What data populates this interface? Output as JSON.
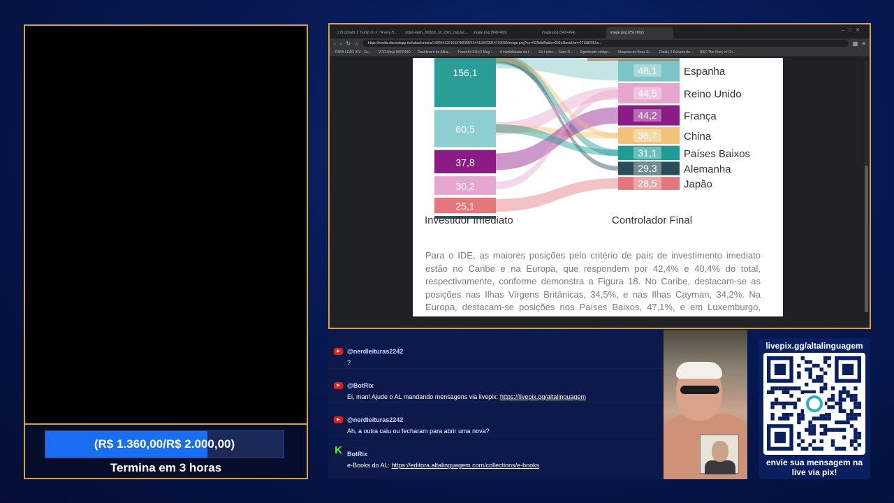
{
  "goal": {
    "progress_text": "(R$ 1.360,00/R$ 2.000,00)",
    "current": 1360,
    "target": 2000,
    "progress_fraction": 0.68,
    "ends_text": "Termina em 3 horas",
    "fill_color": "#1a6ff0"
  },
  "browser": {
    "tabs": [
      {
        "label": "(12) Donald J. Trump no X: \"A very H..."
      },
      {
        "label": "onpel-egim_200910_sri_2001_regulac..."
      },
      {
        "label": "image.png (848×493)"
      },
      {
        "label": "image.png (542×494)"
      },
      {
        "label": "image.png (751×902)"
      }
    ],
    "url": "https://media.discordapp.net/attachments/1435441291633758389/1444115623314723030/image.png?ex=692b8d6a&is=692a3bea&hm=071182951a...",
    "bookmarks": [
      "PAPA LEÃO XIV - Go...",
      "VDO.Ninja MIORMO",
      "Dashboard de Afilia...",
      "Powerful SOLO Mag...",
      "A infalibilidade da I...",
      "De Leicis — Saint R...",
      "Significado código...",
      "Máquina de Boas Ei...",
      "Diablo 2 Resurrecte...",
      "BBC The Story of Ch..."
    ]
  },
  "chart_data": {
    "type": "sankey",
    "left_axis_label": "Investidor Imediato",
    "right_axis_label": "Controlador Final",
    "left_nodes": [
      {
        "value": 156.1,
        "label": "156,1",
        "color": "#2a9d96"
      },
      {
        "value": 60.5,
        "label": "60,5",
        "color": "#8ecdd0"
      },
      {
        "value": 37.8,
        "label": "37,8",
        "color": "#8c1a87"
      },
      {
        "value": 30.2,
        "label": "30,2",
        "color": "#e6a6cf"
      },
      {
        "value": 25.1,
        "label": "25,1",
        "color": "#e5777c"
      }
    ],
    "right_nodes": [
      {
        "name": "Espanha",
        "value": 48.1,
        "label": "48,1",
        "color": "#7cc4c8"
      },
      {
        "name": "Reino Unido",
        "value": 44.5,
        "label": "44,5",
        "color": "#e6a6cf"
      },
      {
        "name": "França",
        "value": 44.2,
        "label": "44,2",
        "color": "#8c1a87"
      },
      {
        "name": "China",
        "value": 36.7,
        "label": "36,7",
        "color": "#f2c27a"
      },
      {
        "name": "Países Baixos",
        "value": 31.1,
        "label": "31,1",
        "color": "#1f9b94"
      },
      {
        "name": "Alemanha",
        "value": 29.3,
        "label": "29,3",
        "color": "#2b4d57"
      },
      {
        "name": "Japão",
        "value": 28.5,
        "label": "28,5",
        "color": "#e5777c"
      }
    ]
  },
  "paragraph": "Para o IDE, as maiores posições pelo critério de país de investimento imediato estão no Caribe e na Europa, que respondem por 42,4% e 40,4% do total, respectivamente, conforme demonstra a Figura 18. No Caribe, destacam-se as posições nas Ilhas Virgens Britânicas, 34,5%, e nas Ilhas Cayman, 34,2%. Na Europa, destacam-se posições nos Países Baixos, 47,1%, e em Luxemburgo, 17,0%.",
  "chat": [
    {
      "platform": "youtube",
      "author": "@nerdleituras2242",
      "text": "?",
      "link": ""
    },
    {
      "platform": "youtube",
      "author": "@BotRix",
      "text": "Ei, man! Ajude o AL mandando mensagens via livepix: ",
      "link": "https://livepix.gg/altalinguagem"
    },
    {
      "platform": "youtube",
      "author": "@nerdleituras2242",
      "text": "Ah, a outra caiu ou fecharam para abrir uma nova?",
      "link": ""
    },
    {
      "platform": "kick",
      "author": "BotRix",
      "text": "e-Books do AL: ",
      "link": "https://editora.altalinguagem.com/collections/e-books"
    }
  ],
  "qr": {
    "title": "livepix.gg/altalinguagem",
    "caption_line1": "envie sua mensagem na",
    "caption_line2": "live via pix!"
  }
}
